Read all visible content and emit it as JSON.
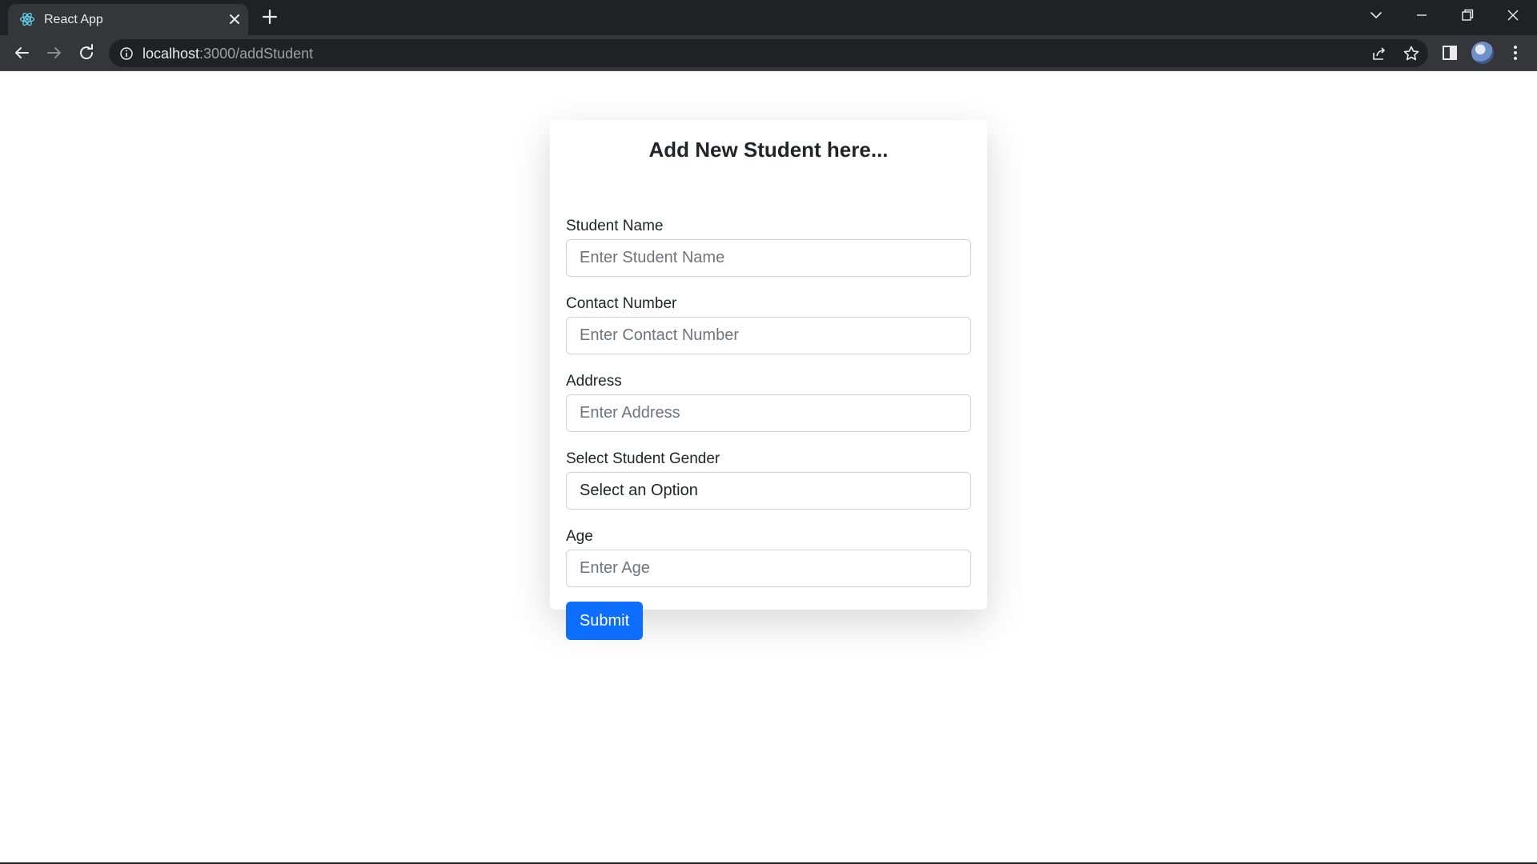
{
  "browser": {
    "tab_title": "React App",
    "url_host": "localhost",
    "url_path": ":3000/addStudent"
  },
  "form": {
    "title": "Add New Student here...",
    "fields": [
      {
        "label": "Student Name",
        "placeholder": "Enter Student Name"
      },
      {
        "label": "Contact Number",
        "placeholder": "Enter Contact Number"
      },
      {
        "label": "Address",
        "placeholder": "Enter Address"
      },
      {
        "label": "Select Student Gender",
        "selected": "Select an Option"
      },
      {
        "label": "Age",
        "placeholder": "Enter Age"
      }
    ],
    "submit_label": "Submit"
  },
  "colors": {
    "primary": "#0d6efd",
    "chrome_dark": "#202124",
    "chrome_tab": "#35363a"
  }
}
